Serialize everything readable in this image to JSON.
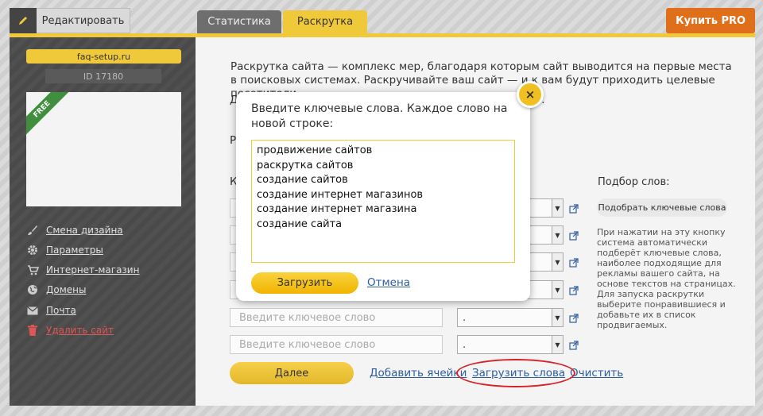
{
  "topbar": {
    "edit_label": "Редактировать",
    "tabs": [
      {
        "label": "Статистика",
        "active": false
      },
      {
        "label": "Раскрутка",
        "active": true
      }
    ],
    "buy_pro_label": "Купить PRO",
    "accent_color": "#f0c93a",
    "pro_color": "#e06f1c"
  },
  "sidebar": {
    "site_name": "faq-setup.ru",
    "site_id": "ID 17180",
    "ribbon": "FREE",
    "items": [
      {
        "label": "Смена дизайна",
        "icon": "brush-icon"
      },
      {
        "label": "Параметры",
        "icon": "gear-icon"
      },
      {
        "label": "Интернет-магазин",
        "icon": "cart-icon"
      },
      {
        "label": "Домены",
        "icon": "globe-icon"
      },
      {
        "label": "Почта",
        "icon": "mail-icon"
      },
      {
        "label": "Удалить сайт",
        "icon": "trash-icon"
      }
    ]
  },
  "main": {
    "intro": "Раскрутка сайта — комплекс мер, благодаря которым сайт выводится на первые места в поисковых системах. Раскручивайте ваш сайт — и к вам будут приходить целевые посетители.",
    "peek_1": "Д",
    "peek_1_tail": "а.",
    "peek_2": "Р",
    "peek_3": "К",
    "keyword_placeholder": "Введите ключевое слово",
    "select_value": ".",
    "words_title": "Подбор слов:",
    "pick_button": "Подобрать ключевые слова",
    "pick_desc": "При нажатии на эту кнопку система автоматически подберёт ключевые слова, наиболее подходящие для рекламы вашего сайта, на основе текстов на страницах. Для запуска раскрутки выберите понравившиеся и добавьте их в список продвигаемых.",
    "next_button": "Далее",
    "add_cells_link": "Добавить ячейки",
    "load_words_link": "Загрузить слова",
    "clear_link": "Очистить"
  },
  "modal": {
    "prompt": "Введите ключевые слова. Каждое слово на новой строке:",
    "keywords_text": "продвижение сайтов\nраскрутка сайтов\nсоздание сайтов\nсоздание интернет магазинов\nсоздание интернет магазина\nсоздание сайта",
    "load_button": "Загрузить",
    "cancel_link": "Отмена",
    "close_glyph": "×"
  }
}
